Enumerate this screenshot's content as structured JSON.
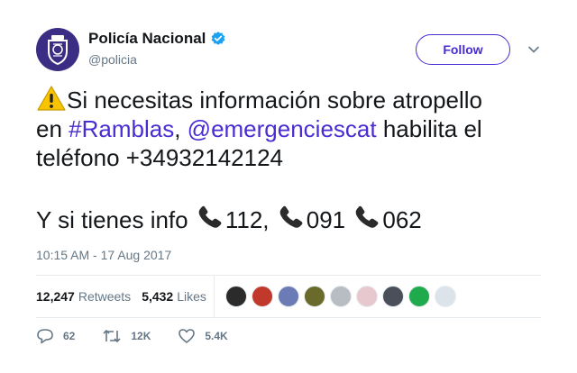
{
  "user": {
    "display_name": "Policía Nacional",
    "handle": "@policia",
    "verified_icon": "verified-badge-icon",
    "avatar_icon": "police-crest-icon"
  },
  "follow": {
    "label": "Follow"
  },
  "tweet": {
    "line1_text": "Si necesitas información sobre atropello",
    "line2_pre": "en ",
    "hashtag": "#Ramblas",
    "line2_mid": ", ",
    "mention": "@emergenciescat",
    "line2_post": " habilita el",
    "line3": "teléfono +34932142124",
    "line4_pre": "Y si tienes info ",
    "num1": "112, ",
    "num2": "091 ",
    "num3": "062"
  },
  "timestamp": "10:15 AM - 17 Aug 2017",
  "stats": {
    "retweets_count": "12,247",
    "retweets_label": "Retweets",
    "likes_count": "5,432",
    "likes_label": "Likes"
  },
  "likers_faces": [
    "#2b2b2b",
    "#c0392b",
    "#6b7bb5",
    "#6a6a2a",
    "#b8bdc4",
    "#e8c8cf",
    "#4a5059",
    "#1faa4b",
    "#dde3ea"
  ],
  "actions": {
    "reply_count": "62",
    "retweet_count": "12K",
    "like_count": "5.4K"
  },
  "colors": {
    "accent": "#4a2cd3",
    "verified": "#1da1f2",
    "muted": "#657786"
  }
}
